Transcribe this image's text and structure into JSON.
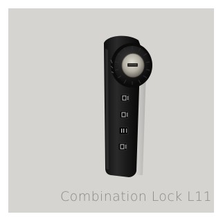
{
  "caption": "Combination Lock L11",
  "photo": {
    "subject": "black cabinet combination lock with silver key cylinder and four number wheels",
    "colors": {
      "background": "#d5d4d1",
      "lock_body": "#1a1a1a",
      "cylinder": "#b8b5ad",
      "caption_text": "#8a8986"
    }
  }
}
